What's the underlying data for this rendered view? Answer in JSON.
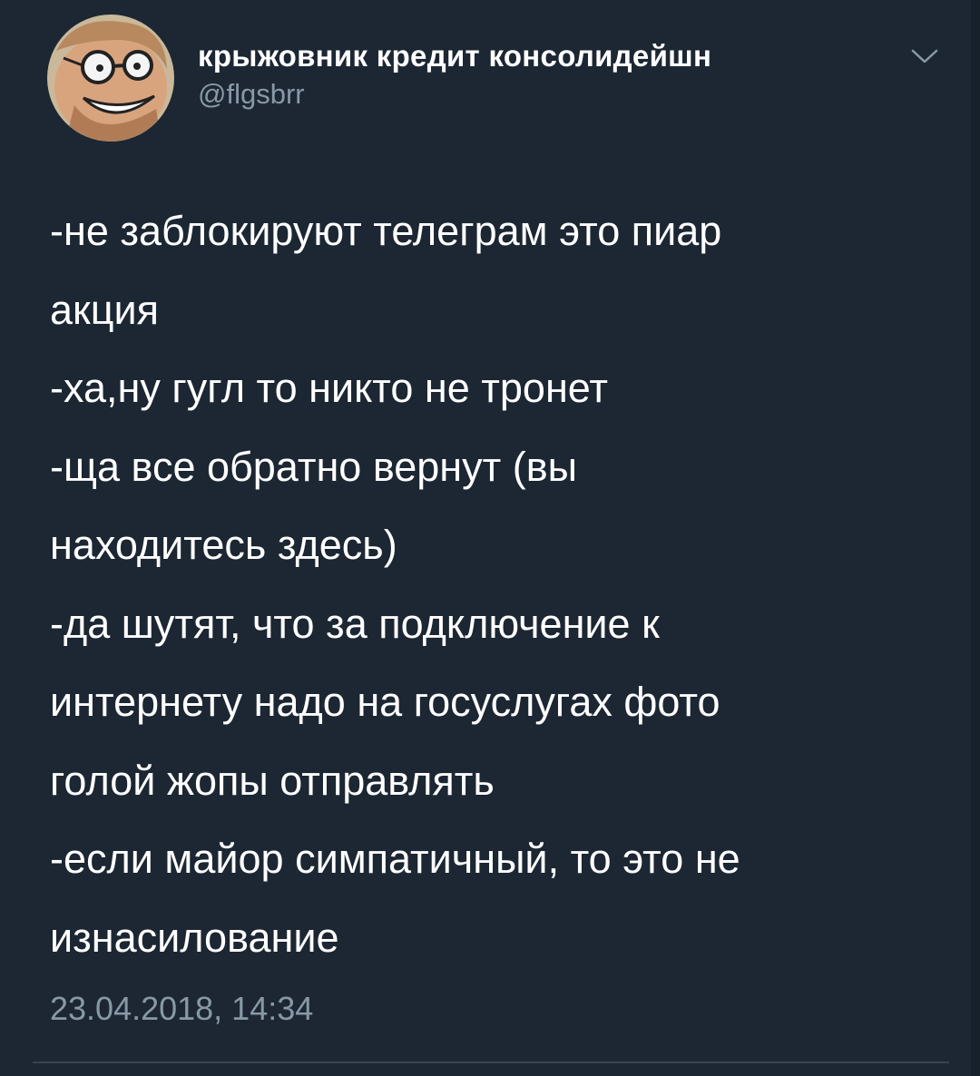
{
  "tweet": {
    "author": {
      "display_name": "крыжовник кредит консолидейшн",
      "handle": "@flgsbrr",
      "avatar_icon": "cartoon-face-with-glasses-avatar"
    },
    "menu_icon": "chevron-down-icon",
    "text_lines": [
      "-не заблокируют телеграм это пиар",
      "акция",
      "-ха,ну гугл то никто не тронет",
      "-ща все обратно вернут (вы",
      "находитесь здесь)",
      "-да шутят, что за подключение к",
      "интернету надо на госуслугах фото",
      "голой жопы отправлять",
      "-если майор симпатичный, то это не",
      "изнасилование"
    ],
    "timestamp": "23.04.2018, 14:34"
  },
  "colors": {
    "background": "#1c2733",
    "primary_text": "#ffffff",
    "secondary_text": "#8899a6",
    "divider": "#38444d"
  }
}
